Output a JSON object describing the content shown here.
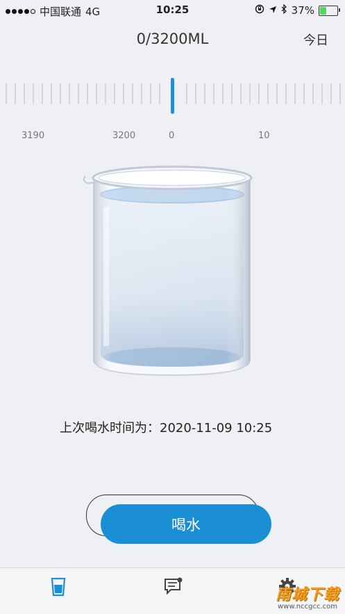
{
  "status": {
    "carrier": "中国联通",
    "network": "4G",
    "time": "10:25",
    "battery": "37%",
    "battery_level": 0.37,
    "icons": [
      "signal-dots-icon",
      "orientation-lock-icon",
      "location-icon",
      "bluetooth-icon",
      "battery-icon"
    ]
  },
  "header": {
    "total": "0/3200ML",
    "today_label": "今日"
  },
  "ruler": {
    "labels": [
      "3190",
      "3200",
      "0",
      "10"
    ],
    "selected_value": 0
  },
  "last_drink": {
    "text": "上次喝水时间为：2020-11-09 10:25"
  },
  "drink_button_label": "喝水",
  "tabs": [
    {
      "name": "tab-water",
      "icon": "glass-icon",
      "active": true
    },
    {
      "name": "tab-messages",
      "icon": "chat-icon",
      "active": false
    },
    {
      "name": "tab-settings",
      "icon": "gear-icon",
      "active": false
    }
  ],
  "watermark": {
    "main": "南城下载",
    "sub": "www.nccgcc.com"
  },
  "colors": {
    "accent": "#1a8fd3",
    "background": "#eff0f4"
  }
}
